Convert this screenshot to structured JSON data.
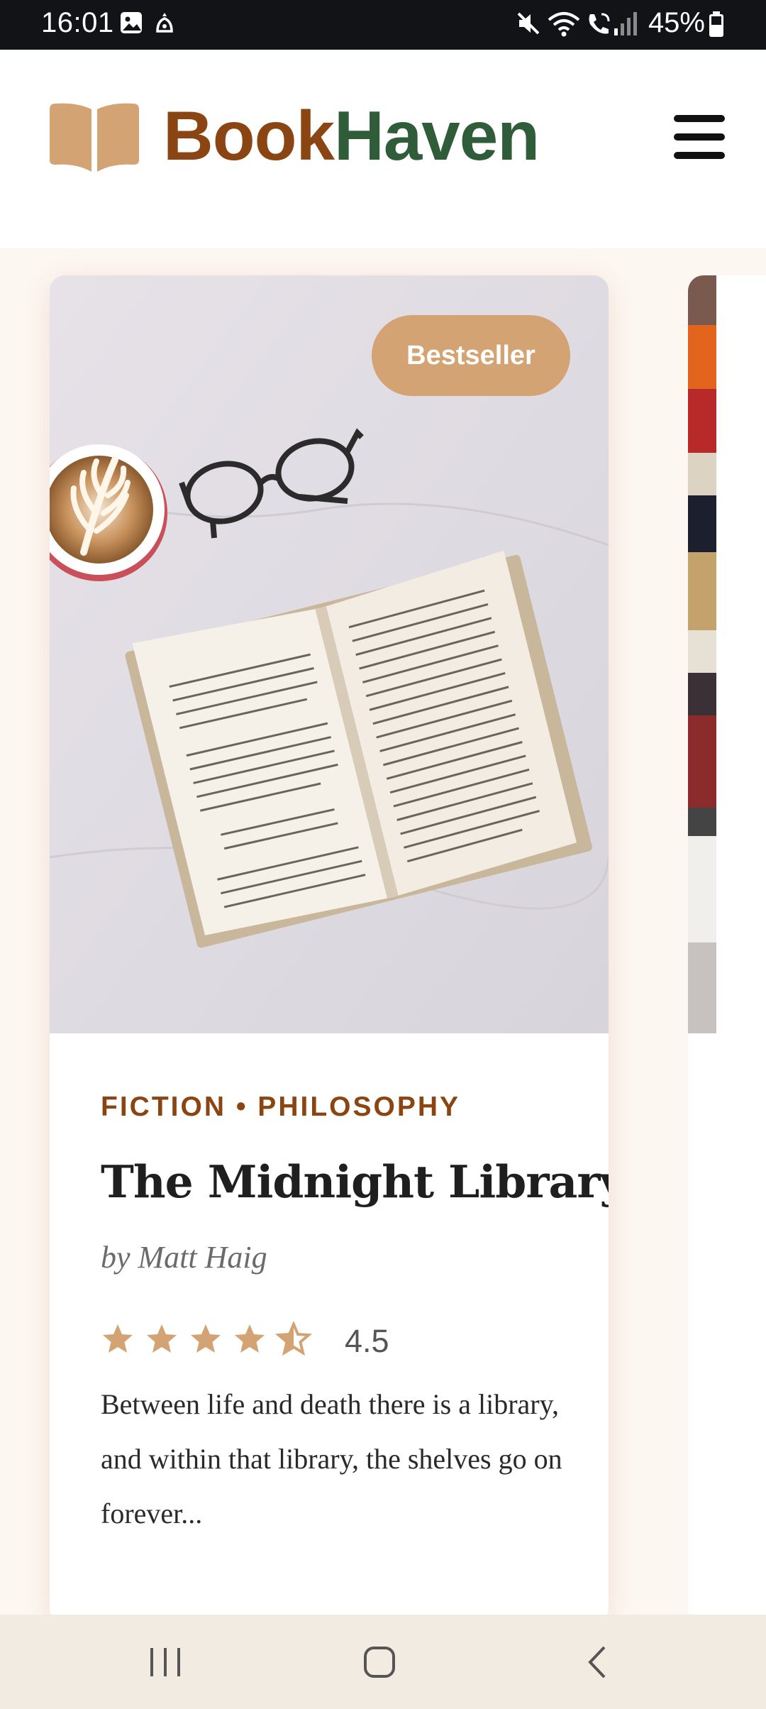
{
  "status_bar": {
    "time": "16:01",
    "battery_percent": "45%",
    "icons": [
      "image-icon",
      "notification-icon",
      "mute-icon",
      "wifi-icon",
      "wifi-calling-icon",
      "signal-icon",
      "battery-icon"
    ]
  },
  "header": {
    "brand_part1": "Book",
    "brand_part2": "Haven",
    "logo_icon": "open-book-icon",
    "menu_icon": "hamburger-menu-icon"
  },
  "colors": {
    "brand_brown": "#8b4513",
    "brand_green": "#2f5d3a",
    "accent_gold": "#d4a373",
    "page_background": "#fdf7f1"
  },
  "featured_book": {
    "badge": "Bestseller",
    "genres": "FICTION • PHILOSOPHY",
    "title": "The Midnight Library",
    "author": "by Matt Haig",
    "rating_value": 4.5,
    "rating_text": "4.5",
    "description": "Between life and death there is a library, and within that library, the shelves go on forever..."
  },
  "nav_bar": {
    "buttons": [
      "recent-apps-button",
      "home-button",
      "back-button"
    ]
  }
}
